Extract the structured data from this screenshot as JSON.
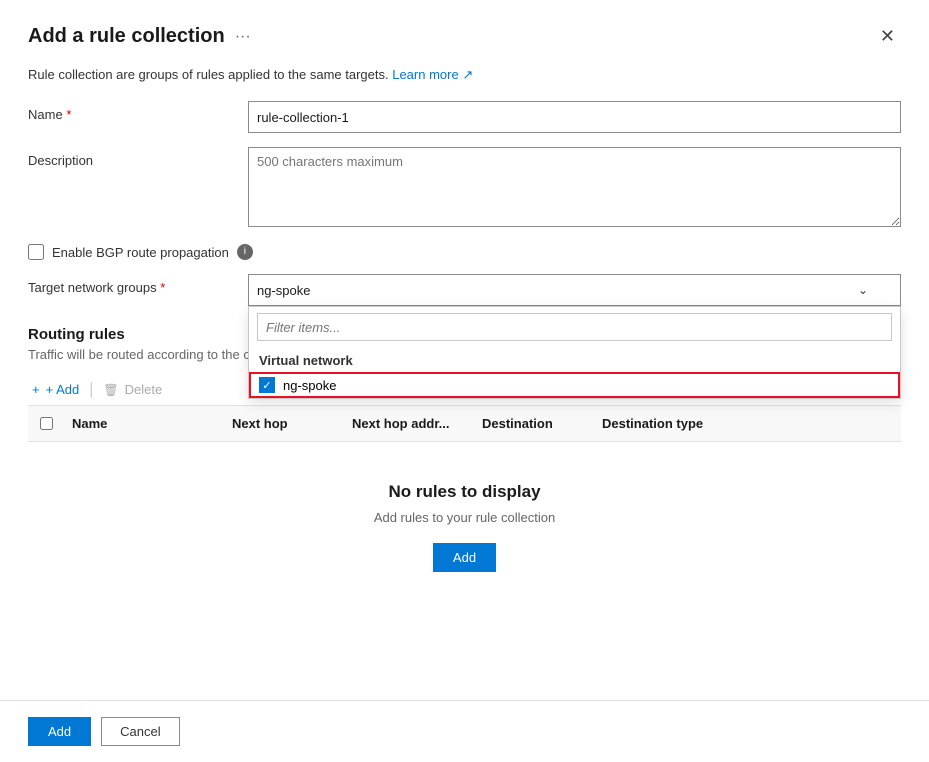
{
  "dialog": {
    "title": "Add a rule collection",
    "more_icon": "···",
    "close_icon": "✕"
  },
  "info_bar": {
    "text": "Rule collection are groups of rules applied to the same targets.",
    "link_text": "Learn more",
    "link_icon": "↗"
  },
  "form": {
    "name_label": "Name",
    "name_required": "*",
    "name_value": "rule-collection-1",
    "description_label": "Description",
    "description_placeholder": "500 characters maximum",
    "bgp_label": "Enable BGP route propagation",
    "bgp_info": "i",
    "target_network_label": "Target network groups",
    "target_network_required": "*",
    "target_network_value": "ng-spoke",
    "dropdown_filter_placeholder": "Filter items...",
    "dropdown_section": "Virtual network",
    "dropdown_item": "ng-spoke",
    "dropdown_item_checked": true
  },
  "routing_rules": {
    "title": "Routing rules",
    "description": "Traffic will be routed according to the criteri",
    "add_btn": "+ Add",
    "delete_btn": "Delete"
  },
  "table": {
    "headers": {
      "name": "Name",
      "next_hop": "Next hop",
      "next_hop_addr": "Next hop addr...",
      "destination": "Destination",
      "destination_type": "Destination type"
    },
    "empty_title": "No rules to display",
    "empty_desc": "Add rules to your rule collection",
    "add_btn": "Add"
  },
  "footer": {
    "add_btn": "Add",
    "cancel_btn": "Cancel"
  },
  "icons": {
    "close": "✕",
    "chevron_down": "⌄",
    "checkmark": "✓",
    "external_link": "⧉",
    "plus": "+",
    "trash": "🗑"
  }
}
